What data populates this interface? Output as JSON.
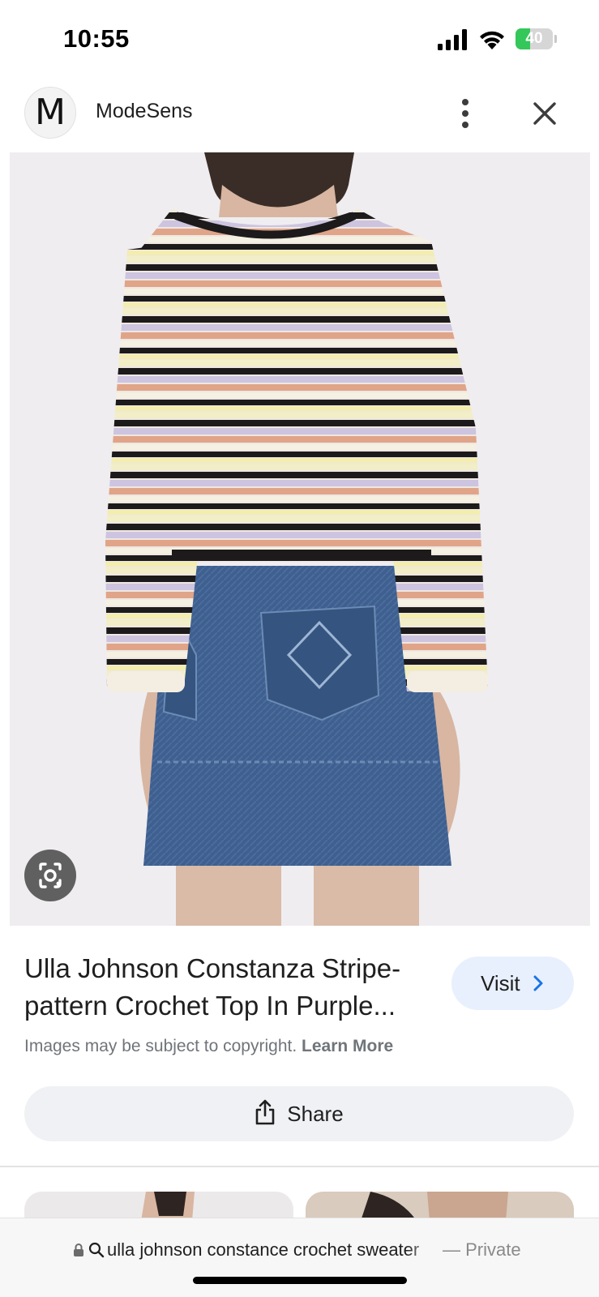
{
  "status_bar": {
    "time": "10:55",
    "battery_percent": 40,
    "battery_label": "40",
    "icons": [
      "signal-icon",
      "wifi-icon",
      "battery-icon"
    ]
  },
  "header": {
    "site_initial": "M",
    "site_name": "ModeSens",
    "icons": [
      "more-vert-icon",
      "close-icon"
    ]
  },
  "image": {
    "description_icon": "google-lens-icon"
  },
  "result": {
    "title": "Ulla Johnson Constanza Stripe-pattern Crochet Top In Purple...",
    "visit_label": "Visit",
    "copyright_text": "Images may be subject to copyright.",
    "learn_more_label": "Learn More",
    "share_label": "Share"
  },
  "browser": {
    "url_query": "ulla johnson constance crochet sweater",
    "private_label": "— Private"
  },
  "colors": {
    "visit_bg": "#e8f0fe",
    "share_bg": "#f0f1f4",
    "battery_green": "#34c759",
    "muted_text": "#70757a"
  }
}
